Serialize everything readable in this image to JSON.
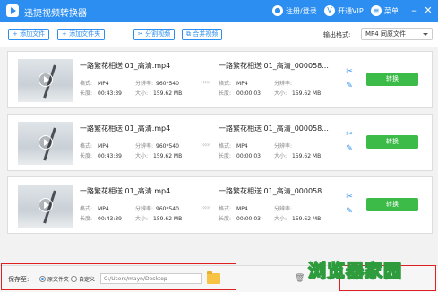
{
  "titlebar": {
    "app_title": "迅捷视频转换器",
    "login": "注册/登录",
    "vip": "开通VIP",
    "menu": "菜单",
    "minimize": "–",
    "close": "✕"
  },
  "toolbar": {
    "add_file": "+ 添加文件",
    "add_folder": "+ 添加文件夹",
    "split_video": "分割视频",
    "merge_video": "合并视频",
    "output_format_label": "输出格式:",
    "output_format_value": "MP4  同原文件"
  },
  "labels": {
    "format": "格式:",
    "resolution": "分辨率:",
    "duration": "长度:",
    "size": "大小:"
  },
  "items": [
    {
      "src_name": "一路繁花相送 01_高清.mp4",
      "src_format": "MP4",
      "src_resolution": "960*540",
      "src_duration": "00:43:39",
      "src_size": "159.62 MB",
      "dst_name": "一路繁花相送 01_高清_000058...",
      "dst_format": "MP4",
      "dst_resolution": "",
      "dst_duration": "00:00:03",
      "dst_size": "159.62 MB",
      "convert_label": "转换"
    },
    {
      "src_name": "一路繁花相送 01_高清.mp4",
      "src_format": "MP4",
      "src_resolution": "960*540",
      "src_duration": "00:43:39",
      "src_size": "159.62 MB",
      "dst_name": "一路繁花相送 01_高清_000058...",
      "dst_format": "MP4",
      "dst_resolution": "",
      "dst_duration": "00:00:03",
      "dst_size": "159.62 MB",
      "convert_label": "转换"
    },
    {
      "src_name": "一路繁花相送 01_高清.mp4",
      "src_format": "MP4",
      "src_resolution": "960*540",
      "src_duration": "00:43:39",
      "src_size": "159.62 MB",
      "dst_name": "一路繁花相送 01_高清_000058...",
      "dst_format": "MP4",
      "dst_resolution": "",
      "dst_duration": "00:00:03",
      "dst_size": "159.62 MB",
      "convert_label": "转换"
    }
  ],
  "footer": {
    "save_to": "保存至:",
    "option_original": "原文件夹",
    "option_custom": "自定义",
    "path_placeholder": "C:/Users/mayn/Desktop"
  },
  "watermark": "浏览器家园",
  "colors": {
    "brand_blue": "#2b8ef0",
    "convert_green": "#3dbb49",
    "highlight_red": "#e02020"
  }
}
